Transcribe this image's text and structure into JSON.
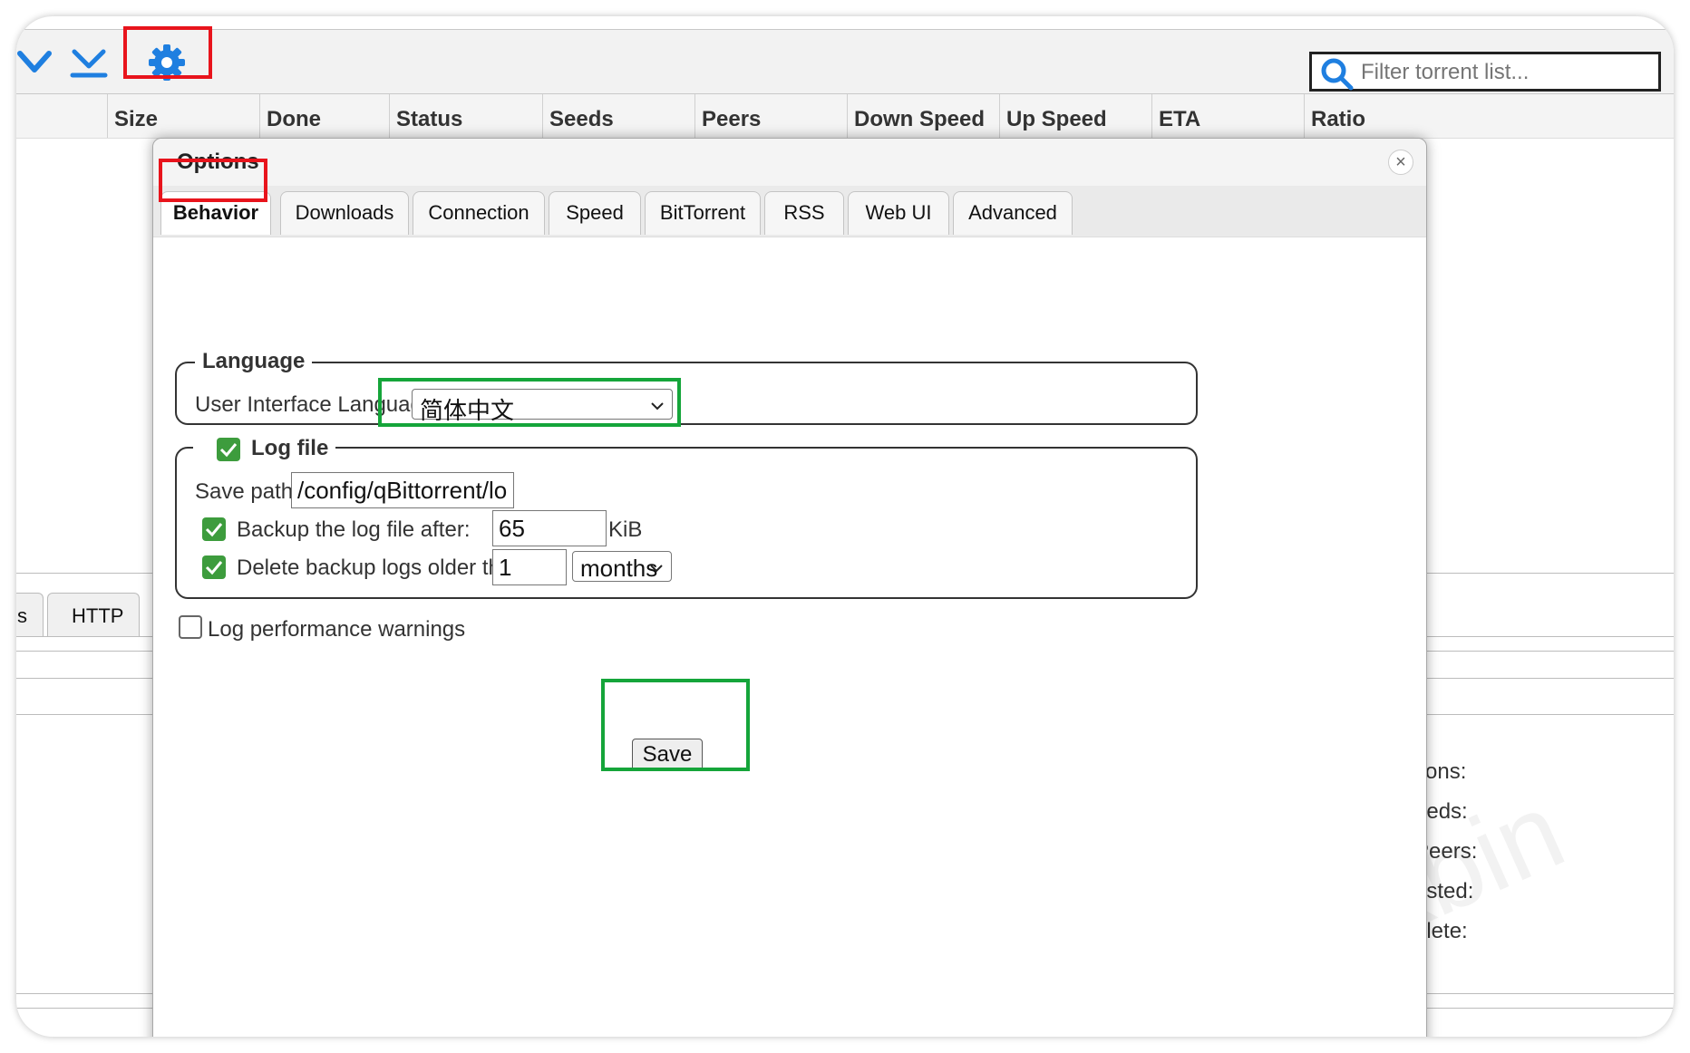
{
  "toolbar": {
    "icons": [
      "chevron-down-icon",
      "download-all-icon",
      "gear-icon"
    ],
    "filter_placeholder": "Filter torrent list..."
  },
  "columns": [
    "Size",
    "Done",
    "Status",
    "Seeds",
    "Peers",
    "Down Speed",
    "Up Speed",
    "ETA",
    "Ratio"
  ],
  "bottom": {
    "tabs": [
      "s",
      "HTTP"
    ],
    "right_labels": [
      "tions:",
      "eeds:",
      "Peers:",
      "asted:",
      "plete:"
    ]
  },
  "watermark": "ckbin",
  "options": {
    "title": "Options",
    "close_label": "×",
    "tabs": [
      "Behavior",
      "Downloads",
      "Connection",
      "Speed",
      "BitTorrent",
      "RSS",
      "Web UI",
      "Advanced"
    ],
    "active_tab": "Behavior",
    "language": {
      "legend": "Language",
      "ui_language_label": "User Interface Language",
      "ui_language_value": "简体中文"
    },
    "log_file": {
      "legend": "Log file",
      "enabled": true,
      "save_path_label": "Save path:",
      "save_path_value": "/config/qBittorrent/logs",
      "backup_label": "Backup the log file after:",
      "backup_checked": true,
      "backup_value": "65",
      "backup_unit": "KiB",
      "delete_label": "Delete backup logs older than:",
      "delete_checked": true,
      "delete_value": "1",
      "delete_unit": "months"
    },
    "perf_warnings_label": "Log performance warnings",
    "perf_warnings_checked": false,
    "save_label": "Save"
  },
  "colors": {
    "icon_blue": "#1f7fe0",
    "highlight_red": "#e8141c",
    "highlight_green": "#15a53a",
    "checkbox_green": "#3d9c3d"
  }
}
